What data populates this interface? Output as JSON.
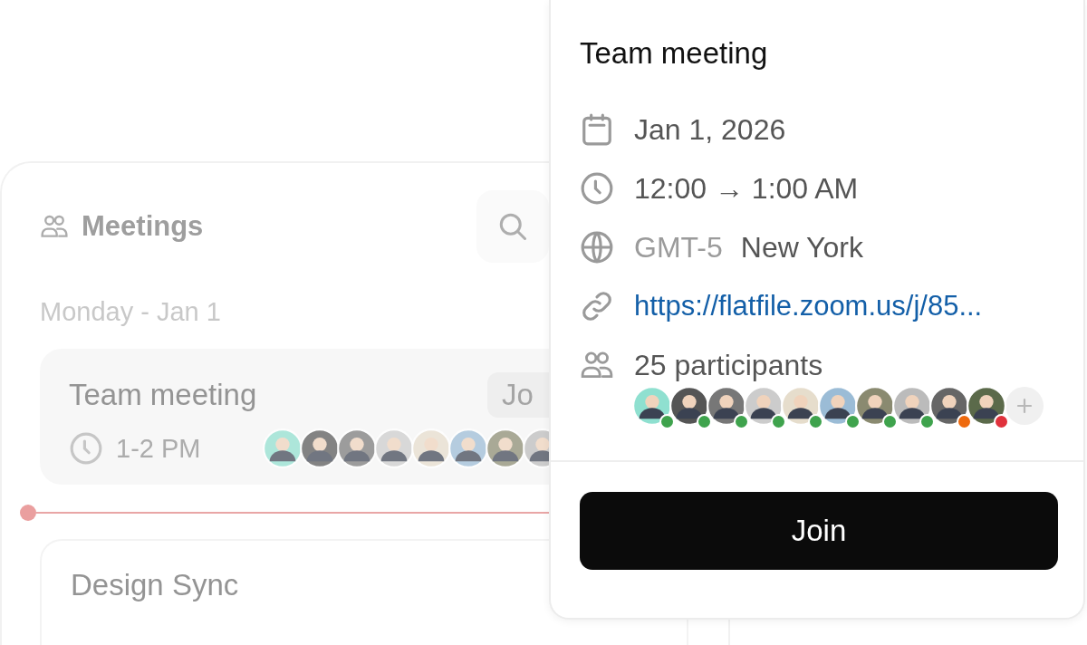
{
  "meetings_panel": {
    "title": "Meetings",
    "day_heading": "Monday - Jan 1",
    "meetings": [
      {
        "title": "Team meeting",
        "join_label": "Jo",
        "time": "1-2 PM"
      },
      {
        "title": "Design Sync"
      }
    ]
  },
  "popover": {
    "title": "Team meeting",
    "date": "Jan 1, 2026",
    "time": "12:00 → 1:00 AM",
    "timezone_offset": "GMT-5",
    "timezone_city": "New York",
    "link": "https://flatfile.zoom.us/j/85...",
    "participants_label": "25 participants",
    "participants": [
      {
        "color": "#3fa34d"
      },
      {
        "color": "#3fa34d"
      },
      {
        "color": "#3fa34d"
      },
      {
        "color": "#3fa34d"
      },
      {
        "color": "#3fa34d"
      },
      {
        "color": "#3fa34d"
      },
      {
        "color": "#3fa34d"
      },
      {
        "color": "#3fa34d"
      },
      {
        "color": "#ee6a0e"
      },
      {
        "color": "#e0323c"
      }
    ],
    "join_label": "Join"
  }
}
